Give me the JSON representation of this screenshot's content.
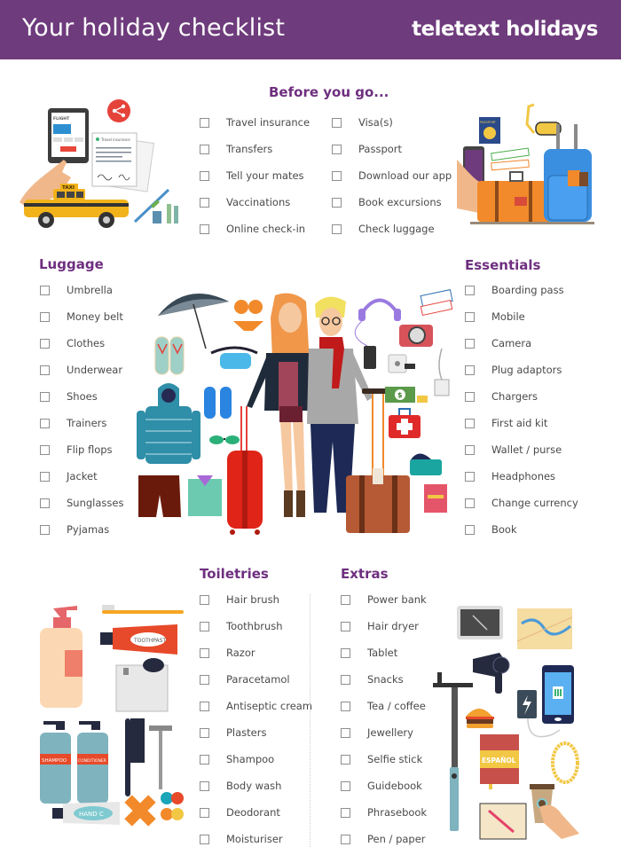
{
  "header": {
    "title": "Your holiday checklist",
    "brand": "teletext holidays",
    "background_color": "#6e3b7c"
  },
  "accent_color": "#6e2f7f",
  "sections": {
    "before": {
      "title": "Before you go...",
      "col1": [
        "Travel insurance",
        "Transfers",
        "Tell your mates",
        "Vaccinations",
        "Online check-in"
      ],
      "col2": [
        "Visa(s)",
        "Passport",
        "Download our app",
        "Book excursions",
        "Check luggage"
      ]
    },
    "luggage": {
      "title": "Luggage",
      "items": [
        "Umbrella",
        "Money belt",
        "Clothes",
        "Underwear",
        "Shoes",
        "Trainers",
        "Flip flops",
        "Jacket",
        "Sunglasses",
        "Pyjamas"
      ]
    },
    "essentials": {
      "title": "Essentials",
      "items": [
        "Boarding pass",
        "Mobile",
        "Camera",
        "Plug adaptors",
        "Chargers",
        "First aid kit",
        "Wallet / purse",
        "Headphones",
        "Change currency",
        "Book"
      ]
    },
    "toiletries": {
      "title": "Toiletries",
      "items": [
        "Hair brush",
        "Toothbrush",
        "Razor",
        "Paracetamol",
        "Antiseptic cream",
        "Plasters",
        "Shampoo",
        "Body wash",
        "Deodorant",
        "Moisturiser"
      ]
    },
    "extras": {
      "title": "Extras",
      "items": [
        "Power bank",
        "Hair dryer",
        "Tablet",
        "Snacks",
        "Tea / coffee",
        "Jewellery",
        "Selfie stick",
        "Guidebook",
        "Phrasebook",
        "Pen / paper"
      ]
    }
  },
  "illustration_text": {
    "taxi": "TAXI",
    "passport": "PASSPORT",
    "toothpaste": "TOOTHPAST",
    "shampoo": "SHAMPOO",
    "conditioner": "CONDITIONER",
    "hand_cream": "HAND C",
    "phrasebook": "ESPAÑOL",
    "flight": "FLIGHT",
    "insurance": "Travel insurance"
  }
}
